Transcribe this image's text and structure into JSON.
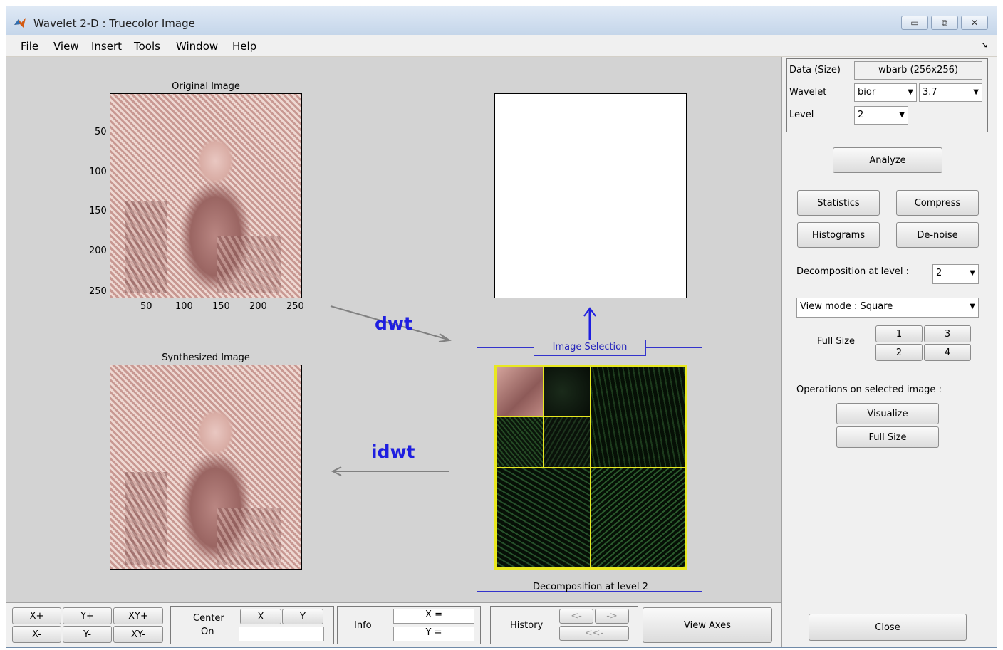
{
  "window": {
    "title": "Wavelet 2-D : Truecolor Image",
    "controls": [
      "▭",
      "⧉",
      "✕"
    ]
  },
  "menu": [
    "File",
    "View",
    "Insert",
    "Tools",
    "Window",
    "Help"
  ],
  "original": {
    "title": "Original Image",
    "y_ticks": [
      "50",
      "100",
      "150",
      "200",
      "250"
    ],
    "x_ticks": [
      "50",
      "100",
      "150",
      "200",
      "250"
    ]
  },
  "synthesized": {
    "title": "Synthesized Image"
  },
  "arrows": {
    "dwt": "dwt",
    "idwt": "idwt"
  },
  "selection": {
    "title": "Image Selection",
    "caption": "Decomposition at level 2"
  },
  "panel": {
    "data_label": "Data  (Size)",
    "data_value": "wbarb  (256x256)",
    "wavelet_label": "Wavelet",
    "wavelet_family": "bior",
    "wavelet_number": "3.7",
    "level_label": "Level",
    "level_value": "2",
    "analyze": "Analyze",
    "statistics": "Statistics",
    "compress": "Compress",
    "histograms": "Histograms",
    "denoise": "De-noise",
    "decomp_level_label": "Decomposition at level :",
    "decomp_level_value": "2",
    "view_mode": "View mode : Square",
    "full_size_label": "Full Size",
    "full_size_buttons": [
      "1",
      "3",
      "2",
      "4"
    ],
    "operations_label": "Operations on selected image :",
    "visualize": "Visualize",
    "full_size": "Full Size",
    "close": "Close"
  },
  "bottom": {
    "zoom": [
      "X+",
      "Y+",
      "XY+",
      "X-",
      "Y-",
      "XY-"
    ],
    "center_label": "Center\nOn",
    "center_on": "Center",
    "center_on2": "On",
    "x_btn": "X",
    "y_btn": "Y",
    "info_label": "Info",
    "info_x": "X =",
    "info_y": "Y =",
    "history_label": "History",
    "hist_back": "<-",
    "hist_fwd": "->",
    "hist_first": "<<-",
    "view_axes": "View Axes"
  }
}
